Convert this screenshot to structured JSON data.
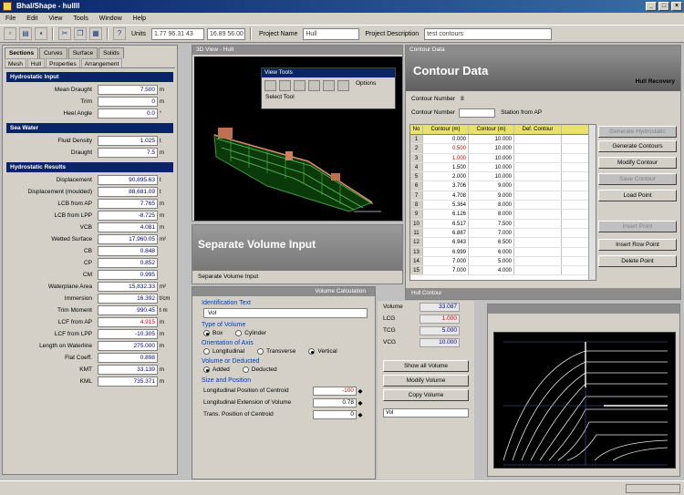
{
  "window": {
    "title": "Bhal/Shape - hullll"
  },
  "menu": [
    "File",
    "Edit",
    "View",
    "Tools",
    "Window",
    "Help"
  ],
  "toolbar": {
    "units_label": "Units",
    "coord1": "1.77 96.31 43",
    "coord2": "16.89 56.00",
    "project_name_label": "Project Name",
    "project_name_value": "Hull",
    "project_description_label": "Project Description",
    "project_description_value": "test contours"
  },
  "left_panel": {
    "tabs": [
      "Sections",
      "Curves",
      "Surface",
      "Solids"
    ],
    "subtabs": [
      "Mesh",
      "Hull",
      "Properties",
      "Arrangement"
    ],
    "sections": [
      {
        "title": "Hydrostatic Input",
        "rows": [
          {
            "label": "Mean Draught",
            "value": "7.500",
            "unit": "m",
            "red": false
          },
          {
            "label": "Trim",
            "value": "0",
            "unit": "m",
            "red": false
          },
          {
            "label": "Heel Angle",
            "value": "0.0",
            "unit": "°",
            "red": false
          }
        ]
      },
      {
        "title": "Sea Water",
        "rows": [
          {
            "label": "Fluid Density",
            "value": "1.025",
            "unit": "t",
            "red": false
          },
          {
            "label": "Draught",
            "value": "7.5",
            "unit": "m",
            "red": false
          }
        ]
      },
      {
        "title": "Hydrostatic Results",
        "rows": [
          {
            "label": "Displacement",
            "value": "90,895.63",
            "unit": "t",
            "red": false
          },
          {
            "label": "Displacement (moulded)",
            "value": "88,681.09",
            "unit": "t",
            "red": false
          },
          {
            "label": "LCB from AP",
            "value": "7.765",
            "unit": "m",
            "red": false
          },
          {
            "label": "LCB from LPP",
            "value": "-8.725",
            "unit": "m",
            "red": false
          },
          {
            "label": "VCB",
            "value": "4.081",
            "unit": "m",
            "red": false
          },
          {
            "label": "Wetted Surface",
            "value": "17,960.05",
            "unit": "m²",
            "red": false
          },
          {
            "label": "CB",
            "value": "0.848",
            "unit": "",
            "red": false
          },
          {
            "label": "CP",
            "value": "0.852",
            "unit": "",
            "red": false
          },
          {
            "label": "CM",
            "value": "0.995",
            "unit": "",
            "red": false
          },
          {
            "label": "Waterplane Area",
            "value": "15,832.33",
            "unit": "m²",
            "red": false
          },
          {
            "label": "Immersion",
            "value": "16.392",
            "unit": "t/cm",
            "red": false
          },
          {
            "label": "Trim Moment",
            "value": "990.45",
            "unit": "t·m",
            "red": false
          },
          {
            "label": "LCF from AP",
            "value": "4.915",
            "unit": "m",
            "red": true
          },
          {
            "label": "LCF from LPP",
            "value": "-10.305",
            "unit": "m",
            "red": false
          },
          {
            "label": "Length on Waterline",
            "value": "275.000",
            "unit": "m",
            "red": false
          },
          {
            "label": "Flat Coeff.",
            "value": "0.898",
            "unit": "",
            "red": false
          },
          {
            "label": "KMT",
            "value": "33.139",
            "unit": "m",
            "red": false
          },
          {
            "label": "KML",
            "value": "735.371",
            "unit": "m",
            "red": false
          }
        ]
      }
    ]
  },
  "view3d": {
    "title": "3D View - Hull"
  },
  "floating_toolbar": {
    "title": "View Tools",
    "label": "Select Tool",
    "button_label": "Options"
  },
  "separate_volume": {
    "title": "Separate Volume Input",
    "bar_label": "Separate Volume Input"
  },
  "input_form": {
    "header": "Volume Calculation",
    "volume_label": "Identification Text",
    "volume_value": "Vol",
    "type_label": "Type of Volume",
    "type_options": [
      {
        "label": "Box",
        "on": true
      },
      {
        "label": "Cylinder",
        "on": false
      }
    ],
    "orientation_label": "Orientation of Axis",
    "orientation_options": [
      {
        "label": "Longitudinal",
        "on": false
      },
      {
        "label": "Transverse",
        "on": false
      },
      {
        "label": "Vertical",
        "on": true
      }
    ],
    "volume_det_label": "Volume or Deducted",
    "volume_det_options": [
      {
        "label": "Added",
        "on": true
      },
      {
        "label": "Deducted",
        "on": false
      }
    ],
    "size_label": "Size and Position",
    "size_rows": [
      {
        "label": "Longitudinal Position of Centroid",
        "value": "-100",
        "red": true
      },
      {
        "label": "Longitudinal Extension of Volume",
        "value": "0.78",
        "red": false
      },
      {
        "label": "Trans. Position of Centroid",
        "value": "0",
        "red": false
      }
    ]
  },
  "results": {
    "rows": [
      {
        "label": "Volume",
        "value": "33.087",
        "red": false
      },
      {
        "label": "LCG",
        "value": "1.000",
        "red": true
      },
      {
        "label": "TCG",
        "value": "5.000",
        "red": false
      },
      {
        "label": "VCG",
        "value": "10.000",
        "red": false
      }
    ],
    "buttons": [
      "Show all Volume",
      "Modify Volume",
      "Copy Volume"
    ],
    "slider_label": "Vol"
  },
  "contour": {
    "header": "Contour Data",
    "title": "Contour Data",
    "right_label": "Hull Recovery",
    "row1_label": "Contour Number",
    "row1_value": "8",
    "row2_label": "Contour Number",
    "row2_extra": "Station from AP",
    "buttons": [
      {
        "label": "Generate Hydrostatic",
        "dim": true
      },
      {
        "label": "Generate Contours",
        "dim": false
      },
      {
        "label": "Modify Contour",
        "dim": false
      },
      {
        "label": "Save Contour",
        "dim": true
      },
      {
        "label": "Load Point",
        "dim": false
      },
      {
        "label": "Insert Point",
        "dim": true
      },
      {
        "label": "Insert Row Point",
        "dim": false
      },
      {
        "label": "Delete Point",
        "dim": false
      }
    ],
    "columns": [
      "No",
      "Contour (m)",
      "Contour (m)",
      "Def. Contour"
    ],
    "rows": [
      {
        "n": "1",
        "a": "0.000",
        "b": "10.000",
        "c": "",
        "red": false
      },
      {
        "n": "2",
        "a": "0.500",
        "b": "10.000",
        "c": "",
        "red": true
      },
      {
        "n": "3",
        "a": "1.000",
        "b": "10.000",
        "c": "",
        "red": true
      },
      {
        "n": "4",
        "a": "1.500",
        "b": "10.000",
        "c": "",
        "red": false
      },
      {
        "n": "5",
        "a": "2.000",
        "b": "10.000",
        "c": "",
        "red": false
      },
      {
        "n": "6",
        "a": "3.706",
        "b": "9.000",
        "c": "",
        "red": false
      },
      {
        "n": "7",
        "a": "4.708",
        "b": "9.000",
        "c": "",
        "red": false
      },
      {
        "n": "8",
        "a": "5.364",
        "b": "8.000",
        "c": "",
        "red": false
      },
      {
        "n": "9",
        "a": "6.126",
        "b": "8.000",
        "c": "",
        "red": false
      },
      {
        "n": "10",
        "a": "6.517",
        "b": "7.500",
        "c": "",
        "red": false
      },
      {
        "n": "11",
        "a": "6.887",
        "b": "7.000",
        "c": "",
        "red": false
      },
      {
        "n": "12",
        "a": "6.943",
        "b": "6.500",
        "c": "",
        "red": false
      },
      {
        "n": "13",
        "a": "6.999",
        "b": "6.000",
        "c": "",
        "red": false
      },
      {
        "n": "14",
        "a": "7.000",
        "b": "5.000",
        "c": "",
        "red": false
      },
      {
        "n": "15",
        "a": "7.000",
        "b": "4.000",
        "c": "",
        "red": false
      }
    ],
    "status": "Hull Contour"
  },
  "statusbar": {
    "right_label": ""
  }
}
